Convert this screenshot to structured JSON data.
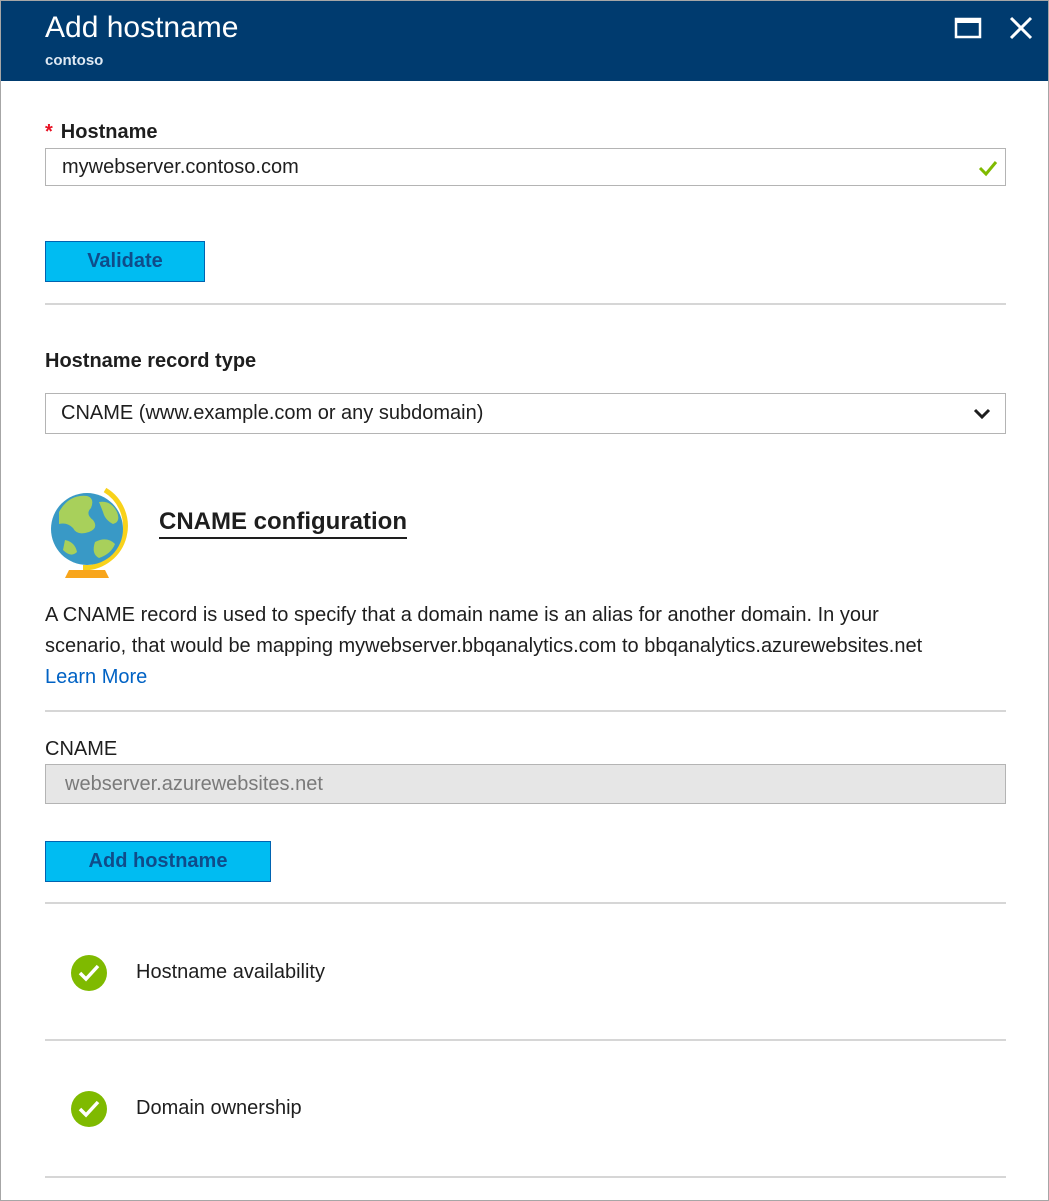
{
  "header": {
    "title": "Add hostname",
    "subtitle": "contoso"
  },
  "hostname": {
    "label": "Hostname",
    "required_marker": "*",
    "value": "mywebserver.contoso.com",
    "valid": true
  },
  "validate_button": "Validate",
  "record_type": {
    "label": "Hostname record type",
    "selected": "CNAME (www.example.com or any subdomain)"
  },
  "cname_section": {
    "title": "CNAME configuration",
    "description_line1": "A CNAME record is used to specify that a domain name is an alias for another domain. In your",
    "description_line2": "scenario, that would be mapping mywebserver.bbqanalytics.com to bbqanalytics.azurewebsites.net",
    "learn_more": "Learn More"
  },
  "cname_field": {
    "label": "CNAME",
    "value": "webserver.azurewebsites.net"
  },
  "add_hostname_button": "Add hostname",
  "checks": [
    {
      "label": "Hostname availability",
      "status": "passed"
    },
    {
      "label": "Domain ownership",
      "status": "passed"
    }
  ],
  "colors": {
    "header_bg": "#003b6f",
    "button_bg": "#00bcf2",
    "success_green": "#7fba00",
    "link_blue": "#0062c4",
    "required_red": "#e81123"
  }
}
